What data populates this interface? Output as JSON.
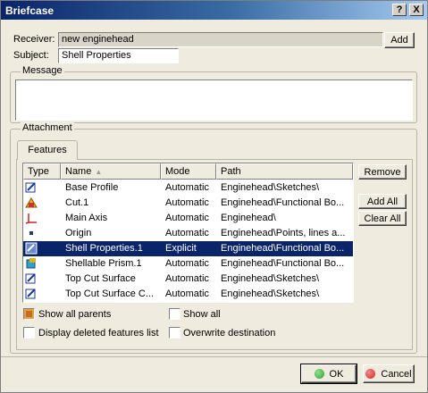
{
  "window": {
    "title": "Briefcase",
    "help_label": "?",
    "close_label": "X"
  },
  "receiver": {
    "label": "Receiver:",
    "value": "new enginehead",
    "add_label": "Add"
  },
  "subject": {
    "label": "Subject:",
    "value": "Shell Properties"
  },
  "message": {
    "label": "Message",
    "value": ""
  },
  "attachment": {
    "label": "Attachment",
    "tab_label": "Features",
    "columns": [
      "Type",
      "Name",
      "Mode",
      "Path"
    ],
    "rows": [
      {
        "icon": "sketch-icon",
        "name": "Base Profile",
        "mode": "Automatic",
        "path": "Enginehead\\Sketches\\",
        "selected": false
      },
      {
        "icon": "cut-icon",
        "name": "Cut.1",
        "mode": "Automatic",
        "path": "Enginehead\\Functional Bo...",
        "selected": false
      },
      {
        "icon": "axis-icon",
        "name": "Main Axis",
        "mode": "Automatic",
        "path": "Enginehead\\",
        "selected": false
      },
      {
        "icon": "origin-icon",
        "name": "Origin",
        "mode": "Automatic",
        "path": "Enginehead\\Points, lines a...",
        "selected": false
      },
      {
        "icon": "shell-icon",
        "name": "Shell Properties.1",
        "mode": "Explicit",
        "path": "Enginehead\\Functional Bo...",
        "selected": true
      },
      {
        "icon": "prism-icon",
        "name": "Shellable Prism.1",
        "mode": "Automatic",
        "path": "Enginehead\\Functional Bo...",
        "selected": false
      },
      {
        "icon": "sketch-icon",
        "name": "Top Cut Surface",
        "mode": "Automatic",
        "path": "Enginehead\\Sketches\\",
        "selected": false
      },
      {
        "icon": "sketch-icon",
        "name": "Top Cut Surface C...",
        "mode": "Automatic",
        "path": "Enginehead\\Sketches\\",
        "selected": false
      }
    ],
    "remove_label": "Remove",
    "add_all_label": "Add All",
    "clear_all_label": "Clear All"
  },
  "options": {
    "show_all_parents": {
      "label": "Show all parents",
      "checked": true
    },
    "show_all": {
      "label": "Show all",
      "checked": false
    },
    "display_deleted": {
      "label": "Display deleted features list",
      "checked": false
    },
    "overwrite_destination": {
      "label": "Overwrite destination",
      "checked": false
    }
  },
  "footer": {
    "ok_label": "OK",
    "cancel_label": "Cancel"
  },
  "colors": {
    "selected_row": "#0a246a",
    "ok_dot": "#2ca02c",
    "cancel_dot": "#d62728"
  }
}
